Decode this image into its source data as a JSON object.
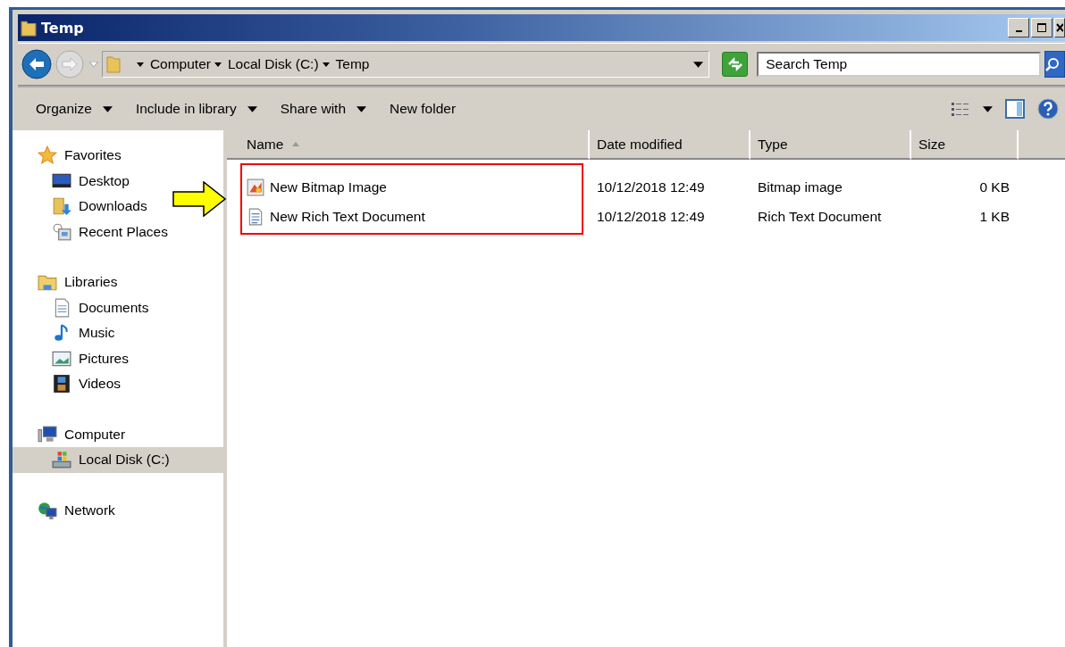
{
  "window": {
    "title": "Temp"
  },
  "address": {
    "crumbs": [
      "Computer",
      "Local Disk (C:)",
      "Temp"
    ]
  },
  "search": {
    "placeholder": "Search Temp"
  },
  "toolbar": [
    {
      "label": "Organize",
      "menu": true
    },
    {
      "label": "Include in library",
      "menu": true
    },
    {
      "label": "Share with",
      "menu": true
    },
    {
      "label": "New folder",
      "menu": false
    }
  ],
  "sidebar": {
    "groups": [
      {
        "label": "Favorites",
        "kind": "star",
        "children": [
          {
            "label": "Desktop",
            "kind": "desktop",
            "selected": false
          },
          {
            "label": "Downloads",
            "kind": "downloads",
            "selected": false
          },
          {
            "label": "Recent Places",
            "kind": "recent",
            "selected": false
          }
        ]
      },
      {
        "label": "Libraries",
        "kind": "library",
        "children": [
          {
            "label": "Documents",
            "kind": "document",
            "selected": false
          },
          {
            "label": "Music",
            "kind": "music",
            "selected": false
          },
          {
            "label": "Pictures",
            "kind": "pictures",
            "selected": false
          },
          {
            "label": "Videos",
            "kind": "videos",
            "selected": false
          }
        ]
      },
      {
        "label": "Computer",
        "kind": "computer",
        "children": [
          {
            "label": "Local Disk (C:)",
            "kind": "disk",
            "selected": true
          }
        ]
      },
      {
        "label": "Network",
        "kind": "network"
      }
    ]
  },
  "table": {
    "columns": [
      {
        "label": "Name",
        "sorted": true
      },
      {
        "label": "Date modified",
        "sorted": false
      },
      {
        "label": "Type",
        "sorted": false
      },
      {
        "label": "Size",
        "sorted": false
      }
    ],
    "rows": [
      {
        "kind": "bitmap",
        "name": "New Bitmap Image",
        "date": "10/12/2018 12:49",
        "type": "Bitmap image",
        "size": "0 KB"
      },
      {
        "kind": "rtf",
        "name": "New Rich Text Document",
        "date": "10/12/2018 12:49",
        "type": "Rich Text Document",
        "size": "1 KB"
      }
    ]
  }
}
